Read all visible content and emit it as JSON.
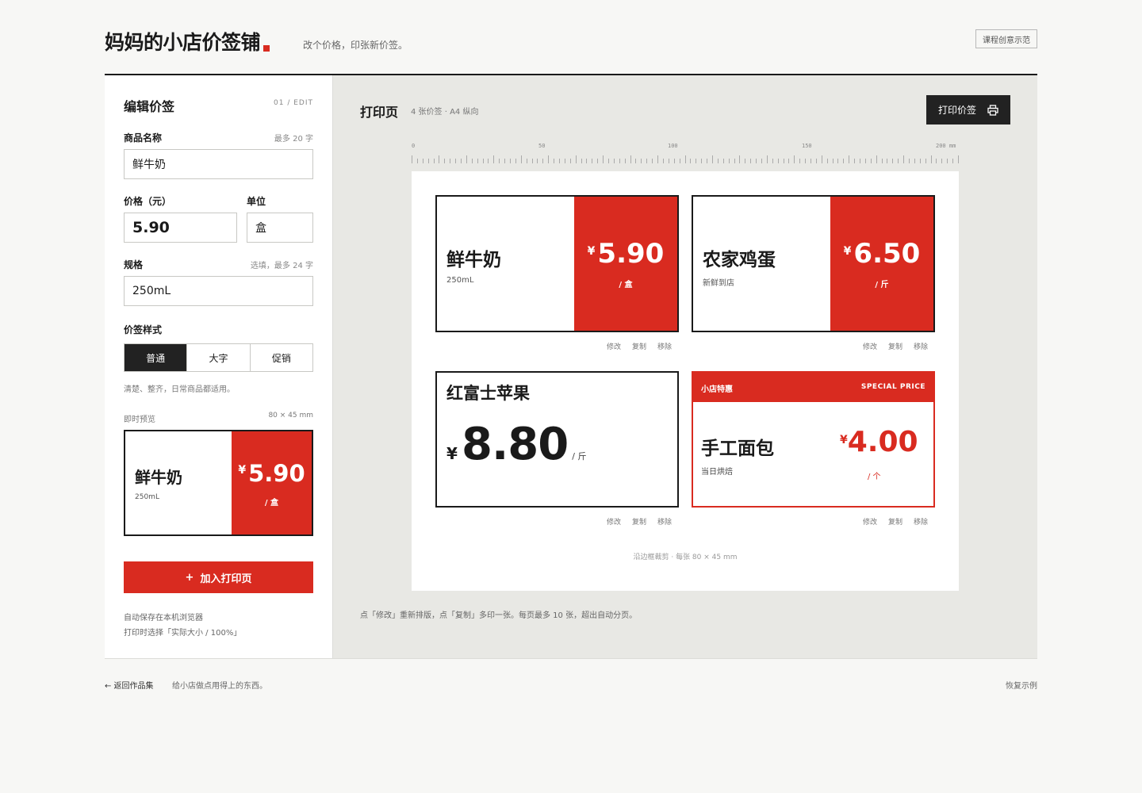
{
  "header": {
    "brand": "妈妈的小店价签铺",
    "tagline": "改个价格，印张新价签。",
    "demo_button": "课程创意示范"
  },
  "editor": {
    "title": "编辑价签",
    "step": "01 / EDIT",
    "name_label": "商品名称",
    "name_hint": "最多 20 字",
    "name_value": "鲜牛奶",
    "price_label": "价格（元）",
    "price_value": "5.90",
    "unit_label": "单位",
    "unit_value": "盒",
    "spec_label": "规格",
    "spec_hint": "选填，最多 24 字",
    "spec_value": "250mL",
    "style_label": "价签样式",
    "styles": [
      "普通",
      "大字",
      "促销"
    ],
    "selected_style": "普通",
    "style_desc": "清楚、整齐，日常商品都适用。",
    "preview_label": "即时预览",
    "preview_size": "80 × 45 mm",
    "add_button": "加入打印页",
    "add_icon": "+",
    "note_autosave": "自动保存在本机浏览器",
    "note_print": "打印时选择「实际大小 / 100%」"
  },
  "preview": {
    "currency": "¥",
    "name": "鲜牛奶",
    "spec": "250mL",
    "price": "5.90",
    "unit": "/ 盒"
  },
  "stage": {
    "title": "打印页",
    "subtitle": "4 张价签 · A4 纵向",
    "print_button": "打印价签",
    "ruler_labels": [
      "0",
      "50",
      "100",
      "150",
      "200 mm"
    ],
    "cut_note": "沿边框裁剪 · 每张 80 × 45 mm",
    "footnote": "点「修改」重新排版，点「复制」多印一张。每页最多 10 张，超出自动分页。",
    "actions": [
      "修改",
      "复制",
      "移除"
    ]
  },
  "tags": [
    {
      "style": "普通",
      "currency": "¥",
      "name": "鲜牛奶",
      "spec": "250mL",
      "price": "5.90",
      "unit": "/ 盒"
    },
    {
      "style": "普通",
      "currency": "¥",
      "name": "农家鸡蛋",
      "spec": "新鲜到店",
      "price": "6.50",
      "unit": "/ 斤"
    },
    {
      "style": "大字",
      "currency": "¥",
      "name": "红富士苹果",
      "spec": "",
      "price": "8.80",
      "unit": "/ 斤"
    },
    {
      "style": "促销",
      "currency": "¥",
      "banner_left": "小店特惠",
      "banner_right": "SPECIAL PRICE",
      "name": "手工面包",
      "spec": "当日烘焙",
      "price": "4.00",
      "unit": "/ 个"
    }
  ],
  "footer": {
    "back_link": "← 返回作品集",
    "slogan": "给小店做点用得上的东西。",
    "restore_link": "恢复示例"
  },
  "colors": {
    "accent": "#d92b20",
    "ink": "#1a1a1a",
    "stage_bg": "#e8e8e4"
  }
}
